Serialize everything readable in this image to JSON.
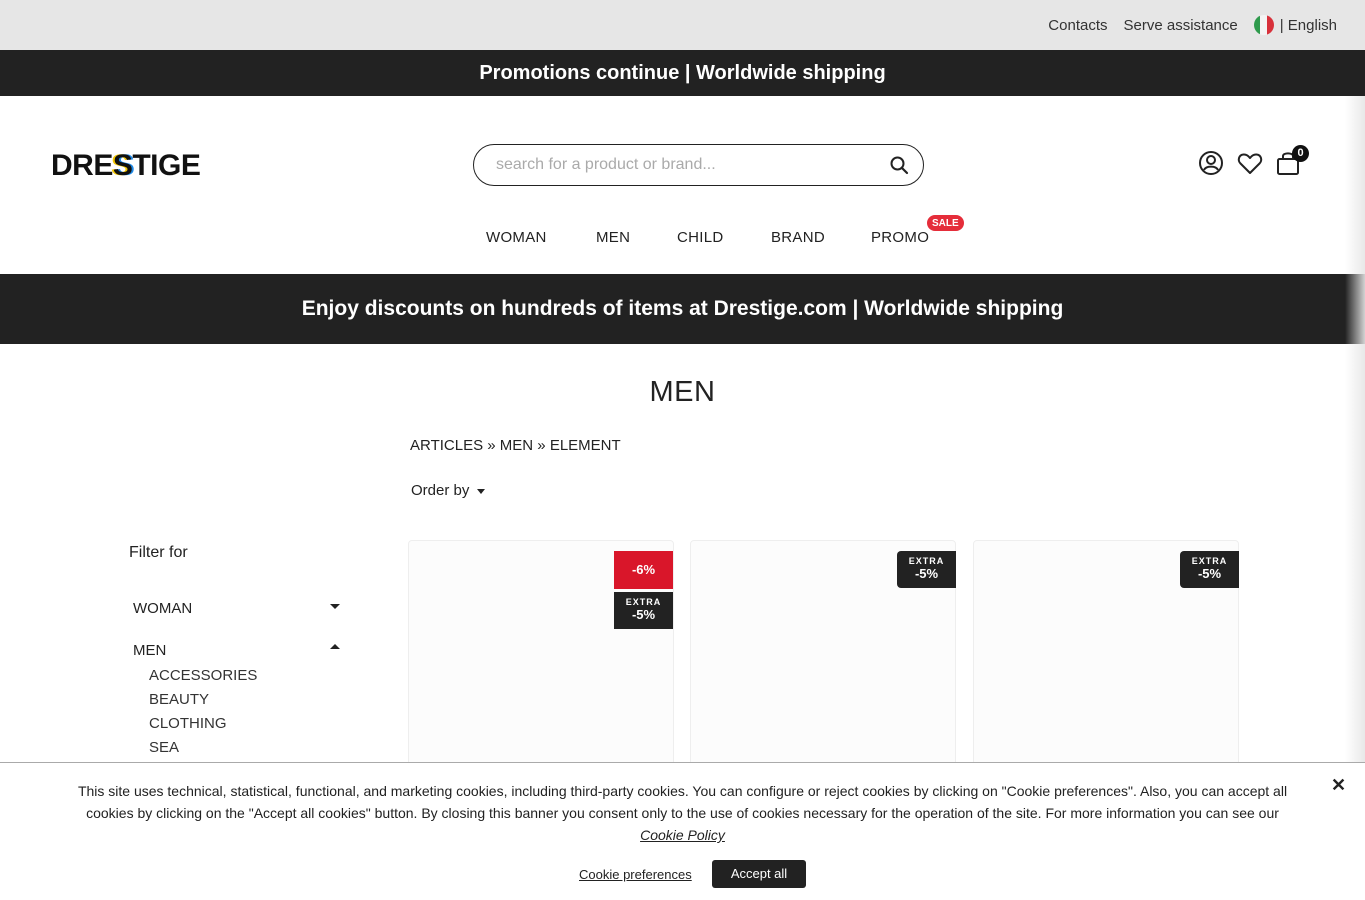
{
  "topbar": {
    "contacts": "Contacts",
    "assistance": "Serve assistance",
    "language": "| English"
  },
  "promo_top": "Promotions continue | Worldwide shipping",
  "logo": {
    "pre": "DRE",
    "mid": "S",
    "post": "TIGE"
  },
  "search": {
    "placeholder": "search for a product or brand..."
  },
  "cart": {
    "count": "0"
  },
  "nav": {
    "woman": "WOMAN",
    "men": "MEN",
    "child": "CHILD",
    "brand": "BRAND",
    "promo": "PROMO",
    "sale_badge": "SALE"
  },
  "promo_banner": "Enjoy discounts on hundreds of items at Drestige.com | Worldwide shipping",
  "page_title": "MEN",
  "breadcrumb": [
    "ARTICLES",
    "»",
    "MEN",
    "»",
    "ELEMENT"
  ],
  "order_by": "Order by",
  "filter": {
    "title": "Filter for",
    "categories": [
      "WOMAN",
      "MEN"
    ],
    "men_subcategories": [
      "ACCESSORIES",
      "BEAUTY",
      "CLOTHING",
      "SEA"
    ]
  },
  "products": [
    {
      "discount": "-6%",
      "extra_label": "EXTRA",
      "extra_value": "-5%"
    },
    {
      "extra_label": "EXTRA",
      "extra_value": "-5%"
    },
    {
      "extra_label": "EXTRA",
      "extra_value": "-5%"
    }
  ],
  "cookie": {
    "text": "This site uses technical, statistical, functional, and marketing cookies, including third-party cookies. You can configure or reject cookies by clicking on \"Cookie preferences\". Also, you can accept all cookies by clicking on the \"Accept all cookies\" button. By closing this banner you consent only to the use of cookies necessary for the operation of the site. For more information you can see our",
    "policy_link": "Cookie Policy",
    "close": "✕",
    "preferences": "Cookie preferences",
    "accept": "Accept all"
  },
  "colors": {
    "dark": "#222222",
    "sale_red": "#e52d3a",
    "discount_red": "#d9162a",
    "topbar_bg": "#e6e6e6"
  },
  "icons": [
    "search-icon",
    "account-icon",
    "heart-icon",
    "bag-icon",
    "flag-italy-icon",
    "close-icon"
  ]
}
